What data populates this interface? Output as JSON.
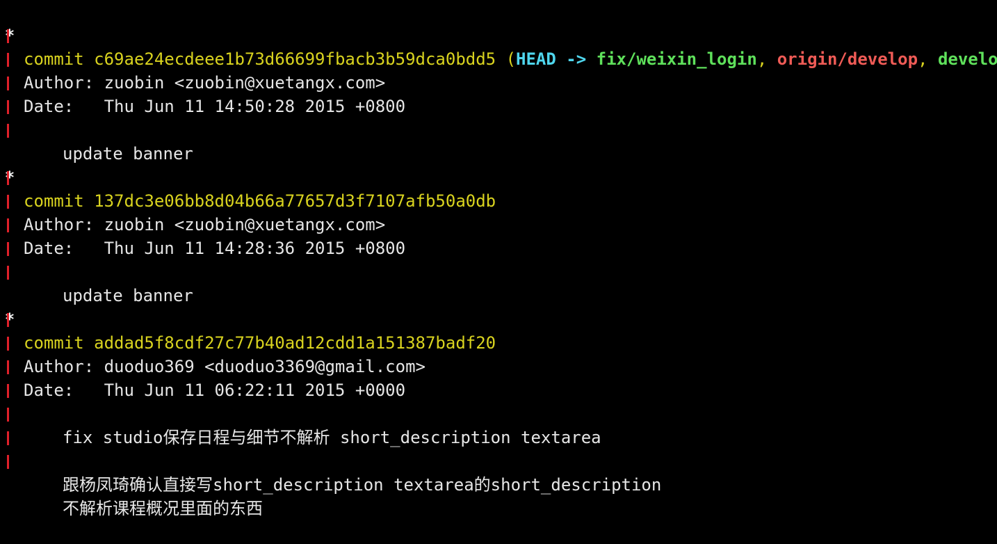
{
  "colors": {
    "background": "#000000",
    "text": "#e6e6e6",
    "commit": "#d9d31f",
    "head": "#4fd6ee",
    "local_branch": "#5fe05b",
    "remote_branch": "#ef5b56",
    "graph_bar": "#e0202a"
  },
  "graph_glyph": "*",
  "commits": [
    {
      "commit_word": "commit",
      "hash": "c69ae24ecdeee1b73d66699fbacb3b59dca0bdd5",
      "refs": {
        "open": "(",
        "head": "HEAD",
        "arrow": "->",
        "branch": "fix/weixin_login",
        "sep1": ",",
        "remote": "origin/develop",
        "sep2": ",",
        "local": "develop",
        "close": ")"
      },
      "author_line": "Author: zuobin <zuobin@xuetangx.com>",
      "date_line": "Date:   Thu Jun 11 14:50:28 2015 +0800",
      "message": [
        "update banner"
      ]
    },
    {
      "commit_word": "commit",
      "hash": "137dc3e06bb8d04b66a77657d3f7107afb50a0db",
      "author_line": "Author: zuobin <zuobin@xuetangx.com>",
      "date_line": "Date:   Thu Jun 11 14:28:36 2015 +0800",
      "message": [
        "update banner"
      ]
    },
    {
      "commit_word": "commit",
      "hash": "addad5f8cdf27c77b40ad12cdd1a151387badf20",
      "author_line": "Author: duoduo369 <duoduo3369@gmail.com>",
      "date_line": "Date:   Thu Jun 11 06:22:11 2015 +0000",
      "message": [
        "fix studio保存日程与细节不解析 short_description textarea",
        "跟杨凤琦确认直接写short_description textarea的short_description",
        "不解析课程概况里面的东西"
      ]
    }
  ]
}
